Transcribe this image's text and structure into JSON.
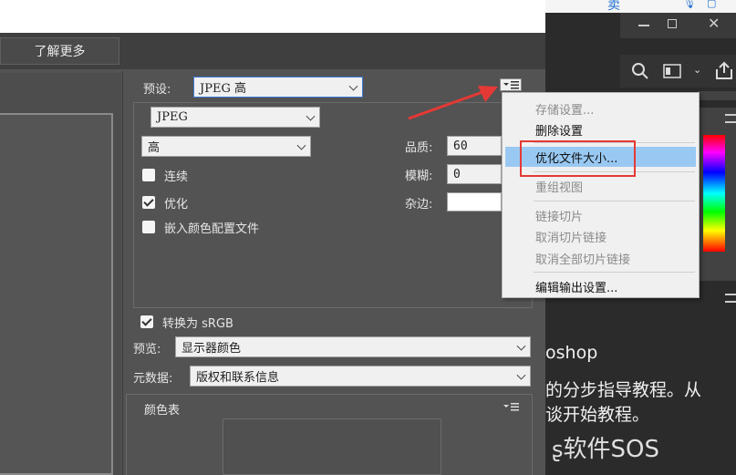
{
  "top_bar": {
    "button": "了解更多"
  },
  "preset": {
    "label": "预设:",
    "value": "JPEG 高"
  },
  "format": {
    "value": "JPEG"
  },
  "quality_preset": {
    "value": "高"
  },
  "options": {
    "progressive": "连续",
    "optimized": "优化",
    "embed_profile": "嵌入颜色配置文件"
  },
  "quality": {
    "label": "品质:",
    "value": "60"
  },
  "blur": {
    "label": "模糊:",
    "value": "0"
  },
  "matte": {
    "label": "杂边:"
  },
  "convert_srgb": {
    "label": "转换为 sRGB"
  },
  "preview": {
    "label": "预览:",
    "value": "显示器颜色"
  },
  "metadata": {
    "label": "元数据:",
    "value": "版权和联系信息"
  },
  "color_table": {
    "label": "颜色表"
  },
  "menu": {
    "items": [
      {
        "label": "存储设置..."
      },
      {
        "label": "删除设置"
      },
      {
        "label": "优化文件大小..."
      },
      {
        "label": "重组视图"
      },
      {
        "label": "链接切片"
      },
      {
        "label": "取消切片链接"
      },
      {
        "label": "取消全部切片链接"
      },
      {
        "label": "编辑输出设置..."
      }
    ]
  },
  "right_panel": {
    "text1": "oshop",
    "text2": "的分步指导教程。从",
    "text3": "谈开始教程。"
  },
  "browser_tab": {
    "text": "卖"
  },
  "watermark": {
    "text": "软件SOS"
  },
  "colors": {
    "accent": "#3c78d8",
    "highlight": "#99c9f2",
    "annotation": "#e53935"
  },
  "icons": [
    "minimize-icon",
    "maximize-icon",
    "close-icon",
    "search-icon",
    "panel-icon",
    "share-icon",
    "panel-menu-icon"
  ]
}
